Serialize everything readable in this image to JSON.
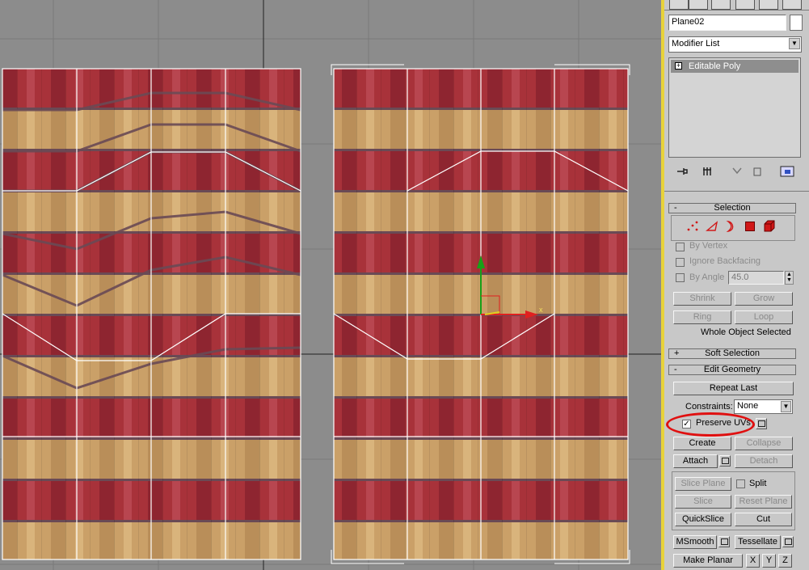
{
  "object_name": "Plane02",
  "modifier_list": "Modifier List",
  "stack": {
    "item": "Editable Poly"
  },
  "rollouts": {
    "selection": {
      "title": "Selection",
      "sign": "-"
    },
    "soft_selection": {
      "title": "Soft Selection",
      "sign": "+"
    },
    "edit_geometry": {
      "title": "Edit Geometry",
      "sign": "-"
    }
  },
  "selection": {
    "by_vertex": "By Vertex",
    "ignore_backfacing": "Ignore Backfacing",
    "by_angle": "By Angle",
    "angle_value": "45.0",
    "shrink": "Shrink",
    "grow": "Grow",
    "ring": "Ring",
    "loop": "Loop",
    "status": "Whole Object Selected"
  },
  "edit_geometry": {
    "repeat_last": "Repeat Last",
    "constraints_label": "Constraints:",
    "constraints_value": "None",
    "preserve_uvs": "Preserve UVs",
    "create": "Create",
    "collapse": "Collapse",
    "attach": "Attach",
    "detach": "Detach",
    "slice_plane": "Slice Plane",
    "split": "Split",
    "slice": "Slice",
    "reset_plane": "Reset Plane",
    "quickslice": "QuickSlice",
    "cut": "Cut",
    "msmooth": "MSmooth",
    "tessellate": "Tessellate",
    "make_planar": "Make Planar",
    "x": "X",
    "y": "Y",
    "z": "Z"
  },
  "gizmo": {
    "x_label": "x"
  },
  "colors": {
    "viewport_bg": "#8c8c8c",
    "stripe_red": "#a8323a",
    "stripe_tan": "#caa068",
    "highlight_ring": "#e01010",
    "active_border": "#e8d23a"
  }
}
